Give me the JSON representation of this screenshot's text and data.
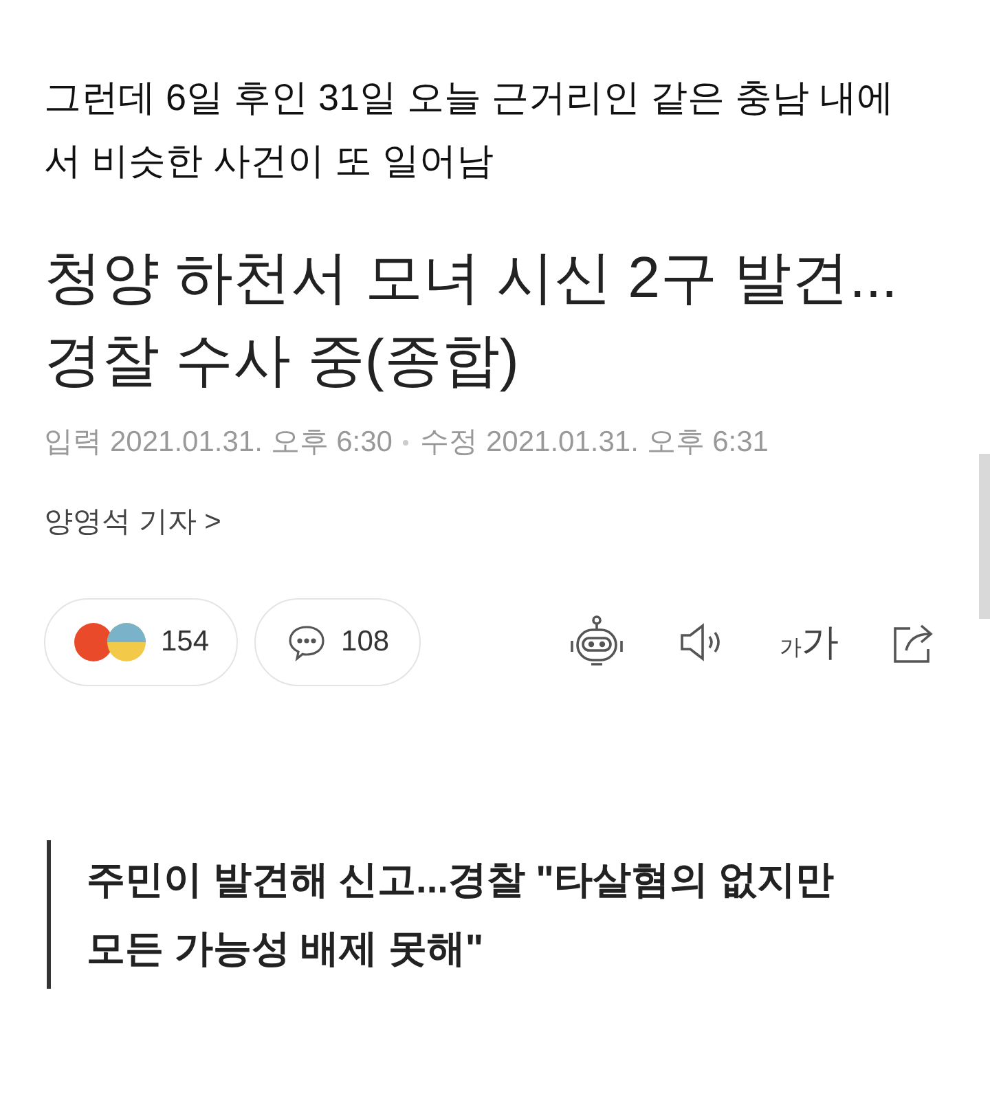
{
  "intro": "그런데 6일 후인 31일 오늘 근거리인 같은 충남 내에서 비슷한 사건이 또 일어남",
  "headline": "청양 하천서 모녀 시신 2구 발견... 경찰 수사 중(종합)",
  "meta": {
    "input_label": "입력",
    "input_time": "2021.01.31. 오후 6:30",
    "edit_label": "수정",
    "edit_time": "2021.01.31. 오후 6:31"
  },
  "reporter": "양영석 기자 >",
  "reactions": {
    "count": "154"
  },
  "comments": {
    "count": "108"
  },
  "font_size_button": {
    "small": "가",
    "large": "가"
  },
  "subheading": "주민이 발견해 신고...경찰 \"타살혐의 없지만 모든 가능성 배제 못해\""
}
